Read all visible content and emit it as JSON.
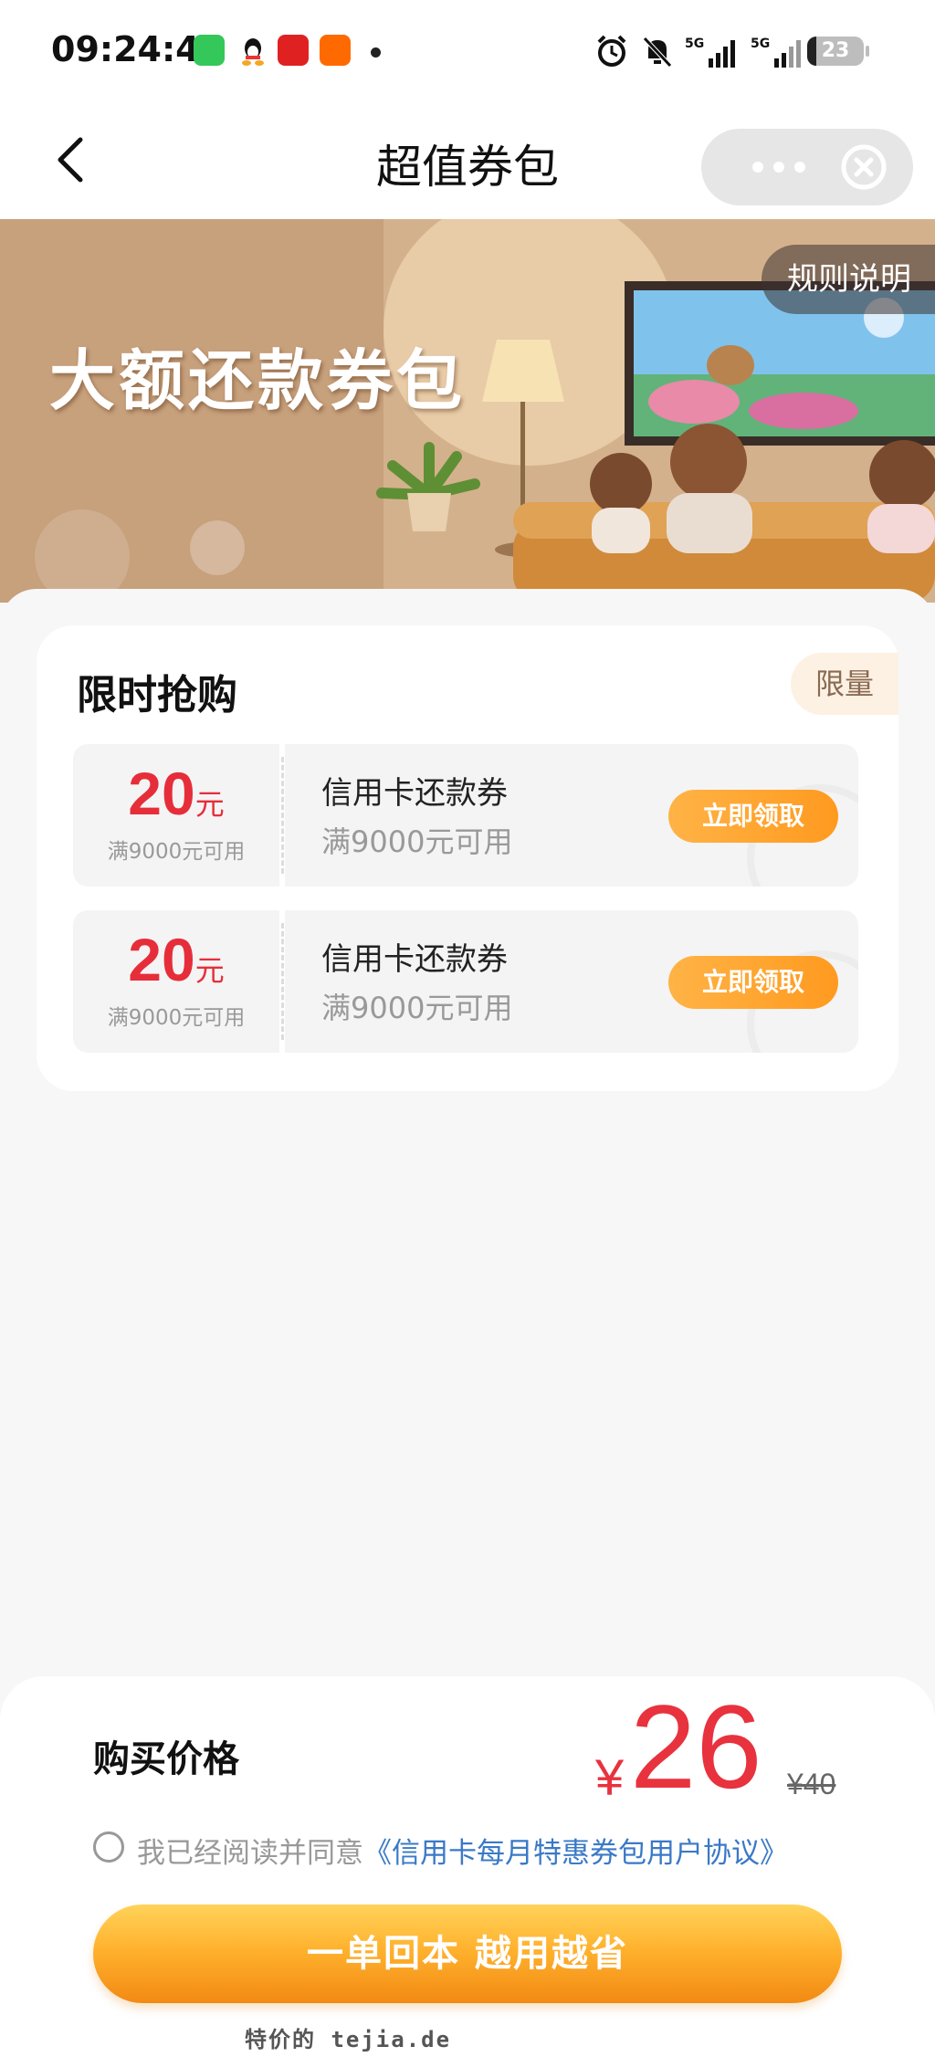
{
  "status_bar": {
    "time": "09:24:49",
    "battery": "23"
  },
  "nav": {
    "title": "超值券包"
  },
  "banner": {
    "title": "大额还款券包",
    "rules_label": "规则说明"
  },
  "flash_sale": {
    "title": "限时抢购",
    "tag": "限量",
    "coupons": [
      {
        "amount": "20",
        "unit": "元",
        "condition_short": "满9000元可用",
        "name": "信用卡还款券",
        "condition": "满9000元可用",
        "button": "立即领取"
      },
      {
        "amount": "20",
        "unit": "元",
        "condition_short": "满9000元可用",
        "name": "信用卡还款券",
        "condition": "满9000元可用",
        "button": "立即领取"
      }
    ]
  },
  "purchase": {
    "label": "购买价格",
    "currency": "¥",
    "price": "26",
    "original_price": "¥40",
    "agree_text": "我已经阅读并同意",
    "agreement_link": "《信用卡每月特惠券包用户协议》",
    "buy_button": "一单回本 越用越省"
  },
  "watermark": "特价的 tejia.de",
  "colors": {
    "accent_red": "#e8323e",
    "button_orange": "#ff9a1f",
    "link_blue": "#3a79c7"
  }
}
